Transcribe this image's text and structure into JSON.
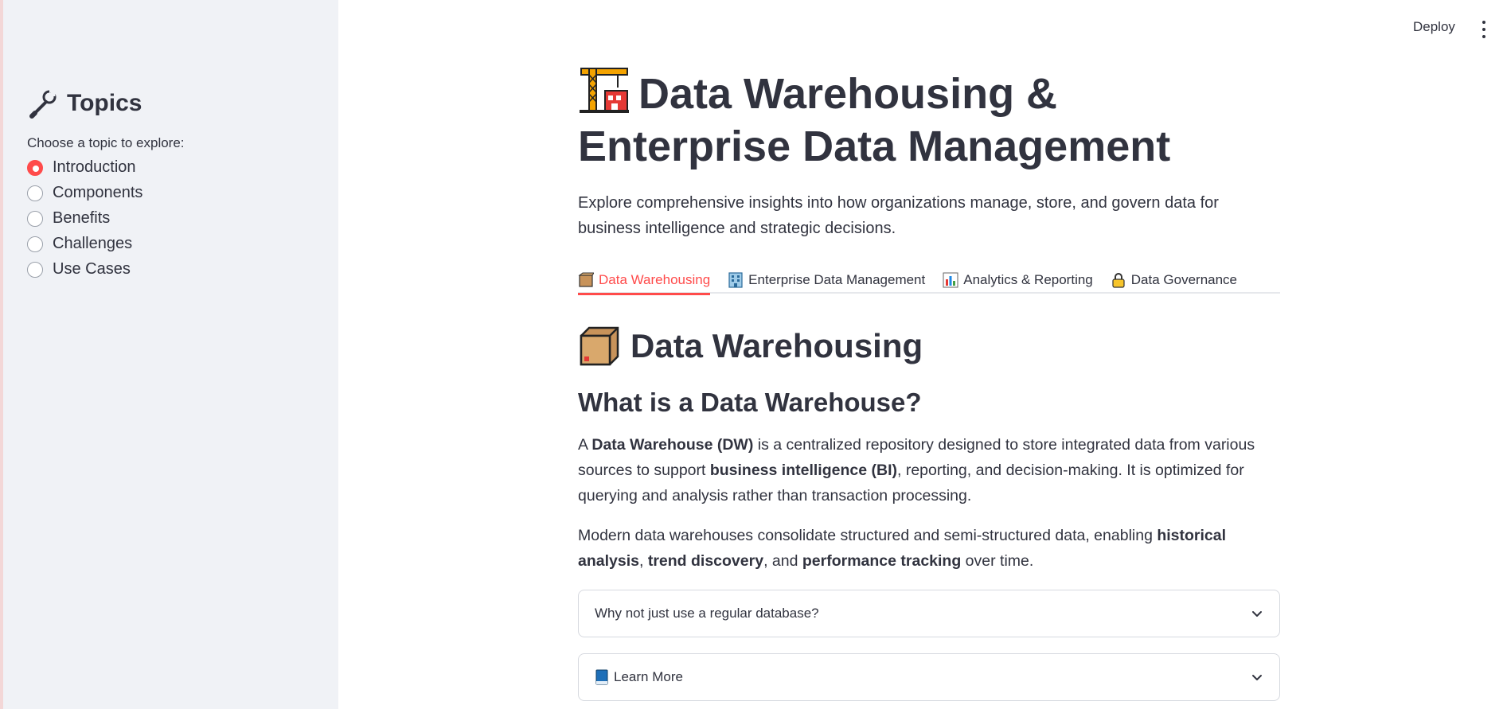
{
  "sidebar": {
    "heading": "Topics",
    "radio_label": "Choose a topic to explore:",
    "options": [
      "Introduction",
      "Components",
      "Benefits",
      "Challenges",
      "Use Cases"
    ],
    "selected": "Introduction"
  },
  "header": {
    "deploy_label": "Deploy"
  },
  "main": {
    "title": "Data Warehousing & Enterprise Data Management",
    "intro": "Explore comprehensive insights into how organizations manage, store, and govern data for business intelligence and strategic decisions.",
    "tabs": [
      {
        "label": "Data Warehousing",
        "icon": "package-icon",
        "active": true
      },
      {
        "label": "Enterprise Data Management",
        "icon": "office-building-icon",
        "active": false
      },
      {
        "label": "Analytics & Reporting",
        "icon": "bar-chart-icon",
        "active": false
      },
      {
        "label": "Data Governance",
        "icon": "lock-icon",
        "active": false
      }
    ],
    "section_title": "Data Warehousing",
    "sub_title": "What is a Data Warehouse?",
    "para1": {
      "t1": "A ",
      "b1": "Data Warehouse (DW)",
      "t2": " is a centralized repository designed to store integrated data from various sources to support ",
      "b2": "business intelligence (BI)",
      "t3": ", reporting, and decision-making. It is optimized for querying and analysis rather than transaction processing."
    },
    "para2": {
      "t1": "Modern data warehouses consolidate structured and semi-structured data, enabling ",
      "b1": "historical analysis",
      "t2": ", ",
      "b2": "trend discovery",
      "t3": ", and ",
      "b3": "performance tracking",
      "t4": " over time."
    },
    "expanders": [
      {
        "label": "Why not just use a regular database?"
      },
      {
        "label": "Learn More",
        "icon": "book-icon"
      }
    ]
  },
  "colors": {
    "accent": "#ff4b4b",
    "sidebar_bg": "#f0f2f6",
    "text": "#31333f"
  }
}
